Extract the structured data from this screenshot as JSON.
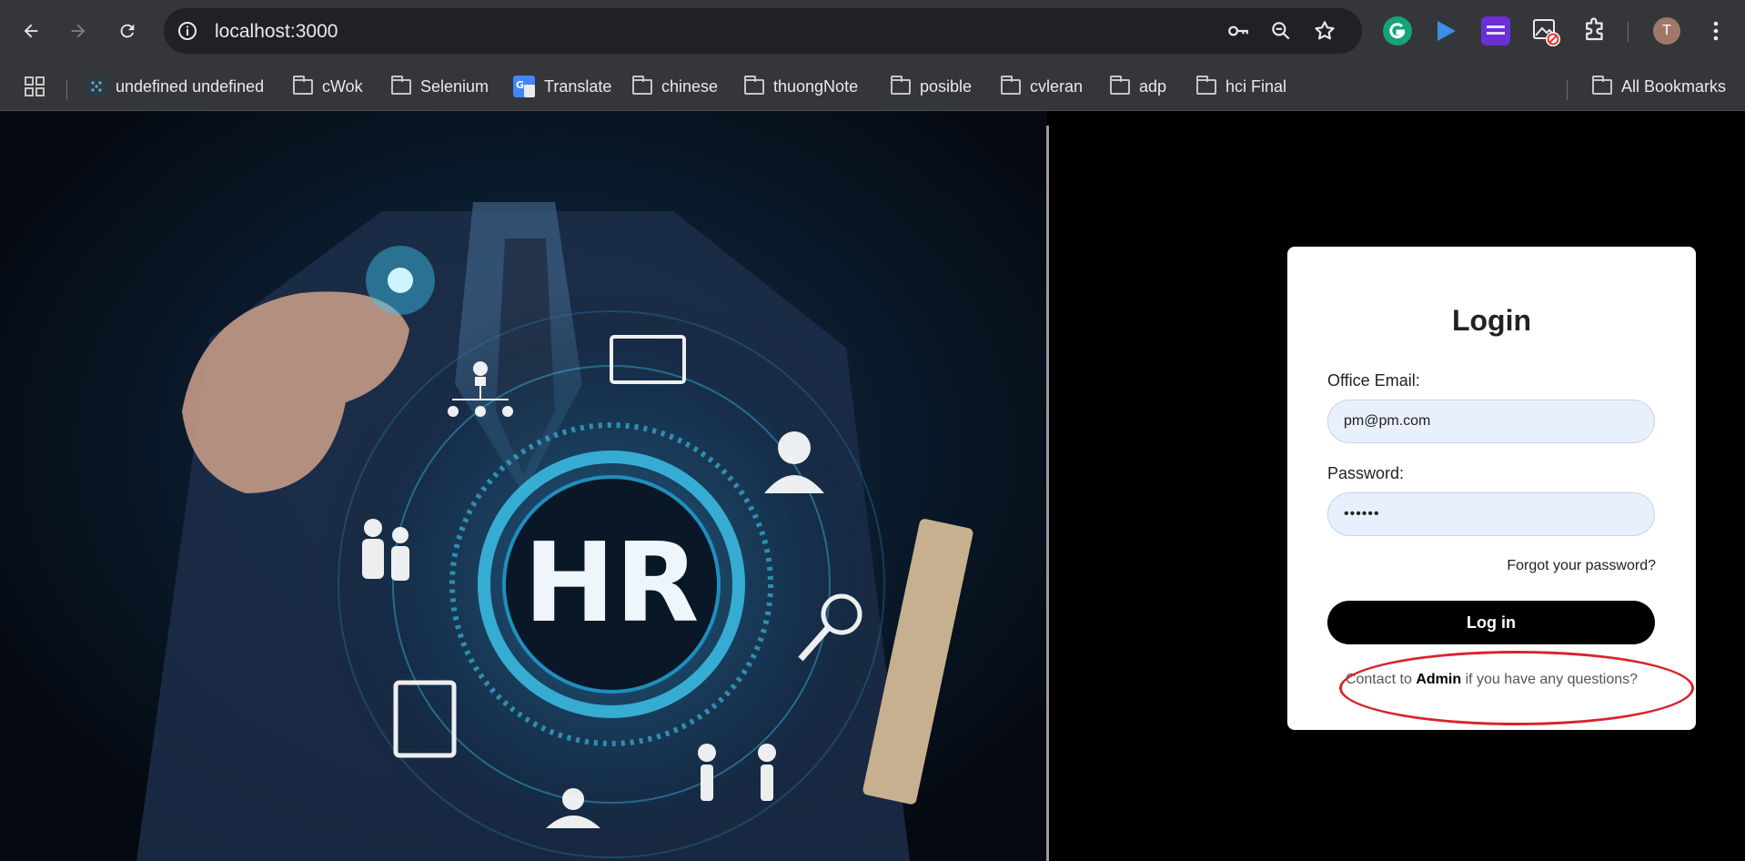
{
  "browser": {
    "url": "localhost:3000",
    "profile_initial": "T",
    "bookmarks": [
      {
        "label": "undefined undefined",
        "icon": "site-icon"
      },
      {
        "label": "cWok",
        "icon": "folder-icon"
      },
      {
        "label": "Selenium",
        "icon": "folder-icon"
      },
      {
        "label": "Translate",
        "icon": "google-translate-icon"
      },
      {
        "label": "chinese",
        "icon": "folder-icon"
      },
      {
        "label": "thuongNote",
        "icon": "folder-icon"
      },
      {
        "label": "posible",
        "icon": "folder-icon"
      },
      {
        "label": "cvleran",
        "icon": "folder-icon"
      },
      {
        "label": "adp",
        "icon": "folder-icon"
      },
      {
        "label": "hci Final",
        "icon": "folder-icon"
      }
    ],
    "all_bookmarks": "All Bookmarks"
  },
  "hero": {
    "text": "HR"
  },
  "login": {
    "title": "Login",
    "email_label": "Office Email:",
    "email_value": "pm@pm.com",
    "password_label": "Password:",
    "password_value": "••••••",
    "forgot_link": "Forgot your password?",
    "submit_label": "Log in",
    "contact_prefix": "Contact to",
    "contact_link": "Admin",
    "contact_suffix": "if you have any questions?"
  },
  "colors": {
    "chrome_bg": "#35363a",
    "omnibox_bg": "#202124",
    "input_bg": "#e8f0fe",
    "button_bg": "#000000",
    "annotation_red": "#d8242b",
    "hr_glow": "#3fc8f0"
  }
}
